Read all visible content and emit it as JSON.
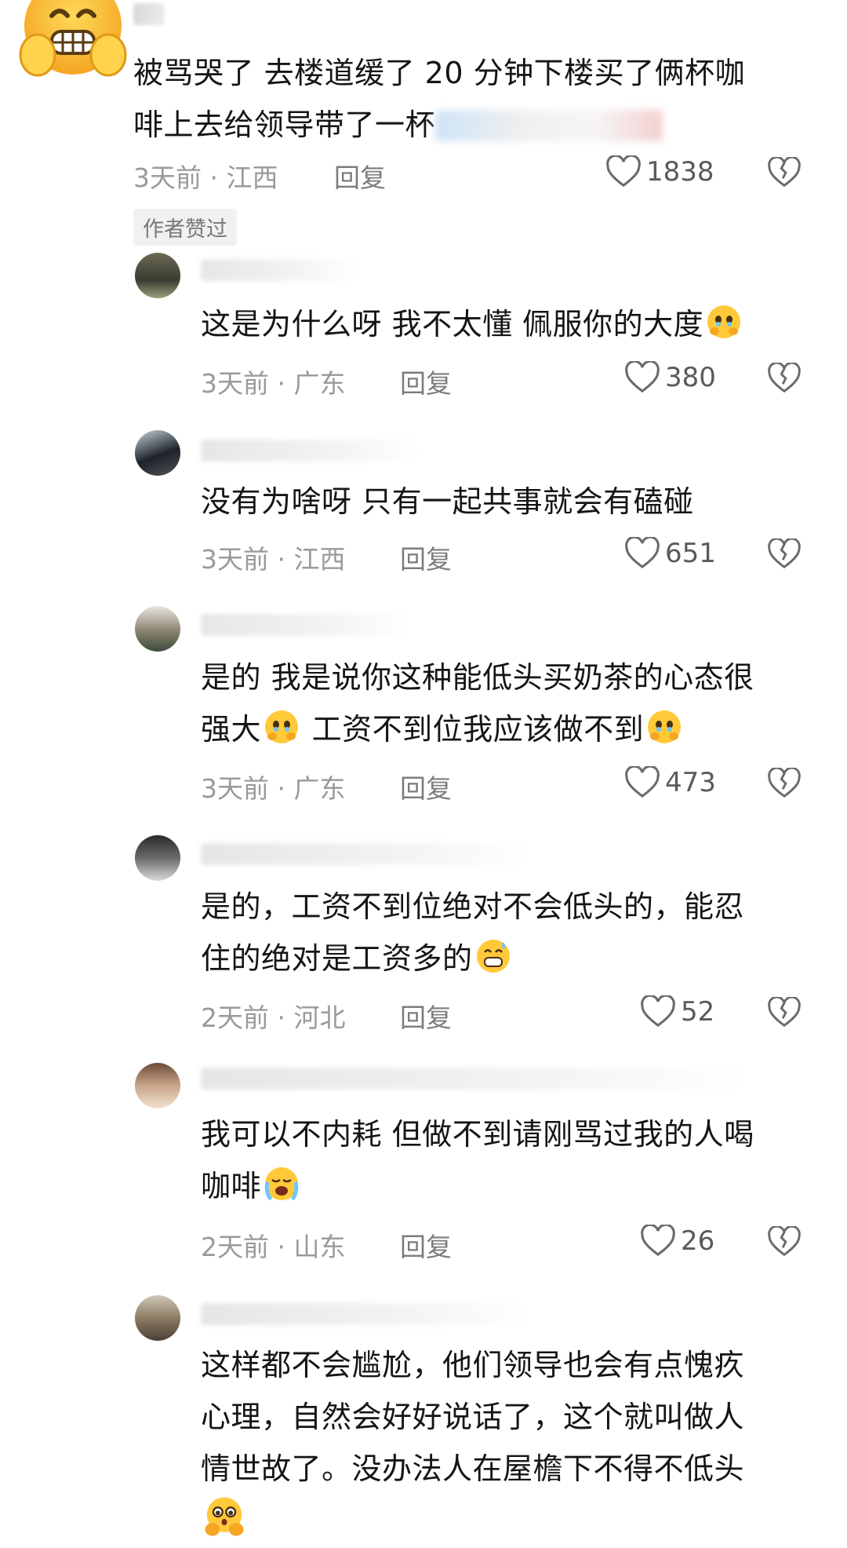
{
  "top_comment": {
    "text_line1": "被骂哭了 去楼道缓了 20 分钟下楼买了俩杯咖",
    "text_line2": "啡上去给领导带了一杯",
    "time": "3天前 · 江西",
    "reply": "回复",
    "likes": "1838",
    "author_badge": "作者赞过"
  },
  "replies": [
    {
      "text": [
        "这是为什么呀 我不太懂 佩服你的大度"
      ],
      "emoji_end": "crying-face",
      "time": "3天前 · 广东",
      "reply": "回复",
      "likes": "380"
    },
    {
      "text": [
        "没有为啥呀 只有一起共事就会有磕碰"
      ],
      "time": "3天前 · 江西",
      "reply": "回复",
      "likes": "651"
    },
    {
      "text_a": "是的 我是说你这种能低头买奶茶的心态很",
      "text_b1": "强大",
      "text_b2": " 工资不到位我应该做不到",
      "time": "3天前 · 广东",
      "reply": "回复",
      "likes": "473"
    },
    {
      "text_a": "是的，工资不到位绝对不会低头的，能忍",
      "text_b": "住的绝对是工资多的",
      "time": "2天前 · 河北",
      "reply": "回复",
      "likes": "52"
    },
    {
      "text_a": "我可以不内耗 但做不到请刚骂过我的人喝",
      "text_b": "咖啡",
      "time": "2天前 · 山东",
      "reply": "回复",
      "likes": "26"
    },
    {
      "text_a": "这样都不会尴尬，他们领导也会有点愧疚",
      "text_b": "心理，自然会好好说话了，这个就叫做人",
      "text_c": "情世故了。没办法人在屋檐下不得不低头"
    }
  ],
  "icons": {
    "like": "heart-outline-icon",
    "dislike": "broken-heart-icon"
  },
  "colors": {
    "text": "#151515",
    "meta": "#9a9a9a",
    "badge_bg": "#f1f1f1",
    "emoji_yellow": "#ffc93a"
  }
}
